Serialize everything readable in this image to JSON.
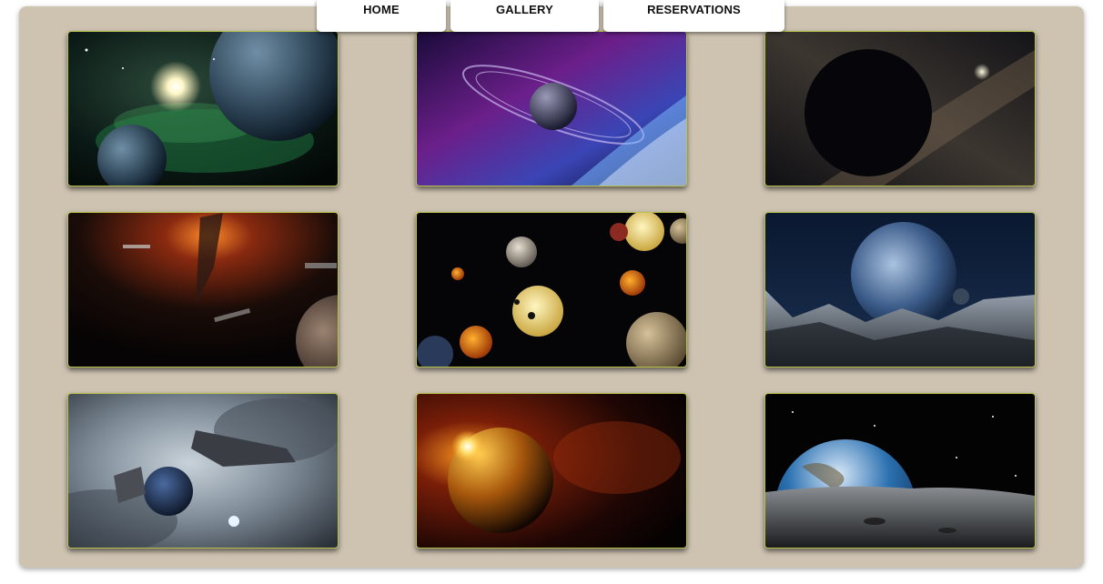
{
  "nav": {
    "home_label": "HOME",
    "gallery_label": "GALLERY",
    "reservations_label": "RESERVATIONS"
  },
  "colors": {
    "panel_background": "#cec3b1",
    "tile_border": "#b9c24a",
    "nav_background": "#ffffff"
  },
  "gallery": {
    "images": [
      {
        "subject": "green nebula with planets and bright star"
      },
      {
        "subject": "ringed planet in purple nebula"
      },
      {
        "subject": "dark planet against milky way"
      },
      {
        "subject": "space battle with fiery explosion"
      },
      {
        "subject": "planetary system with many planets"
      },
      {
        "subject": "planet rising over rocky alien landscape"
      },
      {
        "subject": "spaceships in grey clouds"
      },
      {
        "subject": "golden planet with sun flare"
      },
      {
        "subject": "earth rising over lunar surface"
      }
    ]
  }
}
